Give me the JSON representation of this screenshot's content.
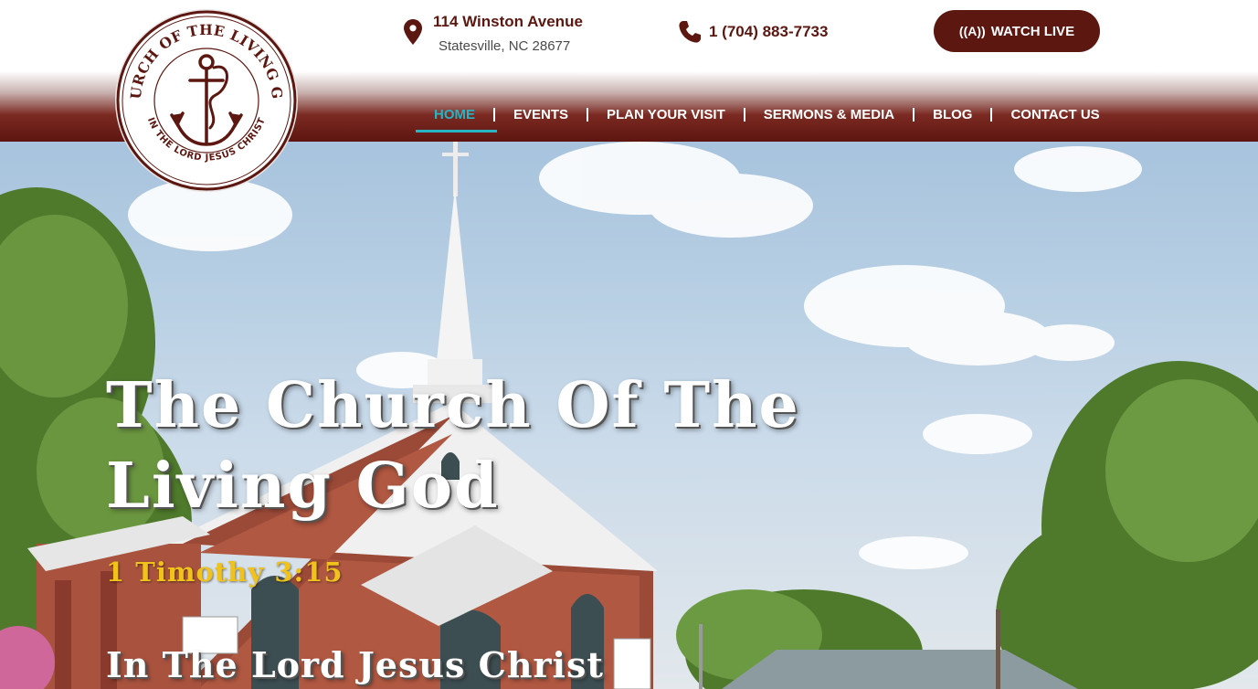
{
  "header": {
    "address_line1": "114 Winston Avenue",
    "address_line2": "Statesville, NC 28677",
    "phone": "1 (704) 883-7733",
    "watch_live_label": "WATCH LIVE",
    "watch_live_icon": "broadcast-icon"
  },
  "logo": {
    "top_text": "CHURCH OF THE LIVING GOD",
    "bottom_text": "IN THE LORD JESUS CHRIST"
  },
  "nav": {
    "items": [
      {
        "label": "HOME",
        "active": true
      },
      {
        "label": "EVENTS",
        "active": false
      },
      {
        "label": "PLAN YOUR VISIT",
        "active": false
      },
      {
        "label": "SERMONS & MEDIA",
        "active": false
      },
      {
        "label": "BLOG",
        "active": false
      },
      {
        "label": "CONTACT US",
        "active": false
      }
    ]
  },
  "hero": {
    "title": "The Church Of The Living God",
    "verse": "1 Timothy 3:15",
    "subtitle": "In The Lord Jesus Christ"
  },
  "colors": {
    "brand": "#5c1710",
    "accent": "#27b4c4",
    "verse": "#f0c21a"
  }
}
